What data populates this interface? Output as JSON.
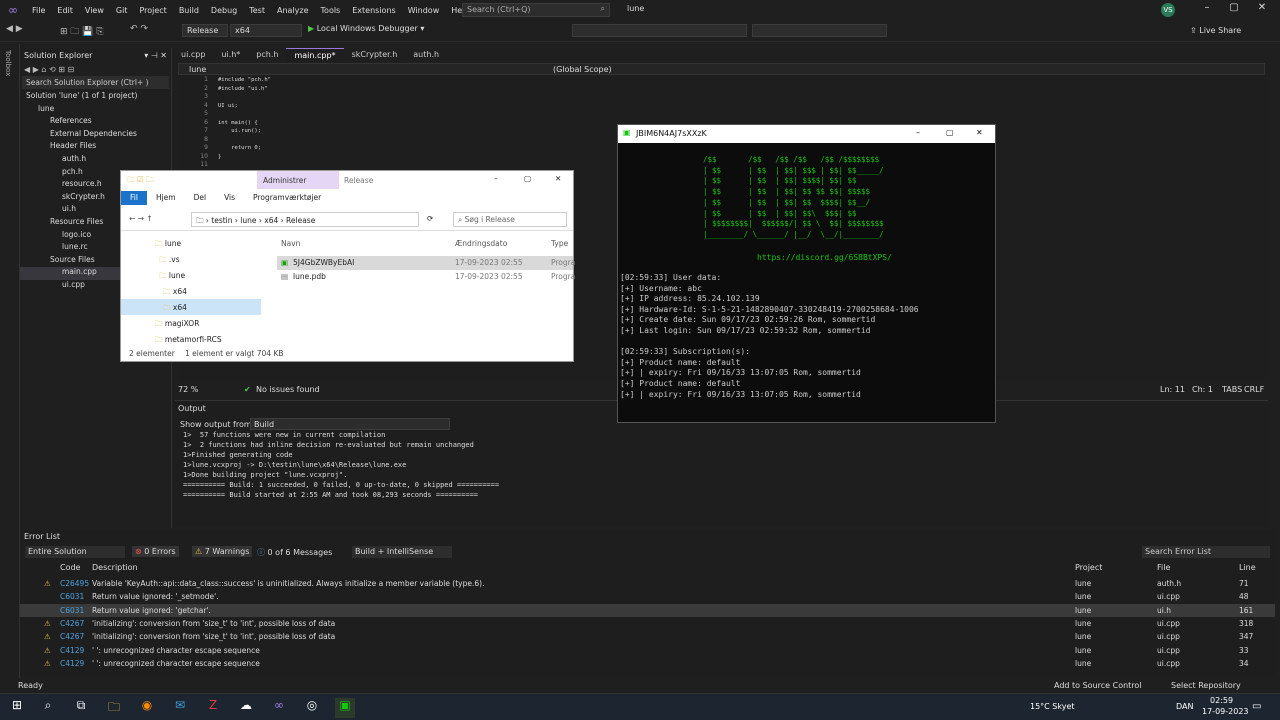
{
  "menu": [
    "File",
    "Edit",
    "View",
    "Git",
    "Project",
    "Build",
    "Debug",
    "Test",
    "Analyze",
    "Tools",
    "Extensions",
    "Window",
    "Help"
  ],
  "search_placeholder": "Search (Ctrl+Q)",
  "solution_name": "lune",
  "user_initials": "VS",
  "toolbar": {
    "config": "Release",
    "platform": "x64",
    "run_label": "Local Windows Debugger",
    "live_share": "Live Share"
  },
  "side_strip": "Toolbox",
  "solution_explorer": {
    "title": "Solution Explorer",
    "search": "Search Solution Explorer (Ctrl+ )",
    "items": [
      {
        "label": "Solution 'lune' (1 of 1 project)",
        "indent": 0
      },
      {
        "label": "lune",
        "indent": 1
      },
      {
        "label": "References",
        "indent": 2
      },
      {
        "label": "External Dependencies",
        "indent": 2
      },
      {
        "label": "Header Files",
        "indent": 2
      },
      {
        "label": "auth.h",
        "indent": 3
      },
      {
        "label": "pch.h",
        "indent": 3
      },
      {
        "label": "resource.h",
        "indent": 3
      },
      {
        "label": "skCrypter.h",
        "indent": 3
      },
      {
        "label": "ui.h",
        "indent": 3
      },
      {
        "label": "Resource Files",
        "indent": 2
      },
      {
        "label": "logo.ico",
        "indent": 3
      },
      {
        "label": "lune.rc",
        "indent": 3
      },
      {
        "label": "Source Files",
        "indent": 2
      },
      {
        "label": "main.cpp",
        "indent": 3
      },
      {
        "label": "ui.cpp",
        "indent": 3
      }
    ]
  },
  "tabs": [
    "ui.cpp",
    "ui.h*",
    "pch.h",
    "main.cpp*",
    "skCrypter.h",
    "auth.h"
  ],
  "nav": {
    "file": "lune",
    "scope": "(Global Scope)"
  },
  "code_lines": [
    "#include \"pch.h\"",
    "#include \"ui.h\"",
    "",
    "UI ui;",
    "",
    "int main() {",
    "    ui.run();",
    "",
    "    return 0;",
    "}",
    ""
  ],
  "editor_status": {
    "zoom": "72 %",
    "issues": "No issues found",
    "ln": "Ln: 11",
    "ch": "Ch: 1",
    "tabs": "TABS",
    "eol": "CRLF"
  },
  "output": {
    "title": "Output",
    "show_from_label": "Show output from:",
    "source": "Build",
    "lines": [
      "1>  57 functions were new in current compilation",
      "1>  2 functions had inline decision re-evaluated but remain unchanged",
      "1>Finished generating code",
      "1>lune.vcxproj -> D:\\testin\\lune\\x64\\Release\\lune.exe",
      "1>Done building project \"lune.vcxproj\".",
      "========== Build: 1 succeeded, 0 failed, 0 up-to-date, 0 skipped ==========",
      "========== Build started at 2:55 AM and took 08,293 seconds =========="
    ]
  },
  "error_list": {
    "title": "Error List",
    "scope": "Entire Solution",
    "errors": "0 Errors",
    "warnings": "7 Warnings",
    "messages": "0 of 6 Messages",
    "build_filter": "Build + IntelliSense",
    "search": "Search Error List",
    "headers": {
      "code": "Code",
      "description": "Description",
      "project": "Project",
      "file": "File",
      "line": "Line"
    },
    "rows": [
      {
        "code": "C26495",
        "desc": "Variable 'KeyAuth::api::data_class::success' is uninitialized. Always initialize a member variable (type.6).",
        "project": "lune",
        "file": "auth.h",
        "line": "71",
        "icon": true
      },
      {
        "code": "C6031",
        "desc": "Return value ignored: '_setmode'.",
        "project": "lune",
        "file": "ui.cpp",
        "line": "48",
        "icon": false
      },
      {
        "code": "C6031",
        "desc": "Return value ignored: 'getchar'.",
        "project": "lune",
        "file": "ui.h",
        "line": "161",
        "icon": false
      },
      {
        "code": "C4267",
        "desc": "'initializing': conversion from 'size_t' to 'int', possible loss of data",
        "project": "lune",
        "file": "ui.cpp",
        "line": "318",
        "icon": true
      },
      {
        "code": "C4267",
        "desc": "'initializing': conversion from 'size_t' to 'int', possible loss of data",
        "project": "lune",
        "file": "ui.cpp",
        "line": "347",
        "icon": true
      },
      {
        "code": "C4129",
        "desc": "' ': unrecognized character escape sequence",
        "project": "lune",
        "file": "ui.cpp",
        "line": "33",
        "icon": true
      },
      {
        "code": "C4129",
        "desc": "' ': unrecognized character escape sequence",
        "project": "lune",
        "file": "ui.cpp",
        "line": "34",
        "icon": true
      }
    ]
  },
  "statusbar": {
    "ready": "Ready",
    "add_source": "Add to Source Control",
    "select_repo": "Select Repository"
  },
  "taskbar": {
    "weather": "15°C  Skyet",
    "lang": "DAN",
    "time": "02:59",
    "date": "17-09-2023"
  },
  "explorer": {
    "ribbon_tab_admin": "Administrer",
    "ribbon_title": "Release",
    "tabs": [
      "Fil",
      "Hjem",
      "Del",
      "Vis",
      "Programværktøjer"
    ],
    "path": [
      "testin",
      "lune",
      "x64",
      "Release"
    ],
    "search": "Søg i Release",
    "tree": [
      "lune",
      ".vs",
      "lune",
      "x64",
      "x64",
      "magiXOR",
      "metamorfi-RCS"
    ],
    "columns": [
      "Navn",
      "Ændringsdato",
      "Type"
    ],
    "files": [
      {
        "name": "5J4GbZWByEbAI",
        "date": "17-09-2023 02:55",
        "type": "Progra"
      },
      {
        "name": "lune.pdb",
        "date": "17-09-2023 02:55",
        "type": "Progra"
      }
    ],
    "status_count": "2 elementer",
    "status_sel": "1 element er valgt  704 KB"
  },
  "console": {
    "title": "JBIM6N4AJ7sXXzK",
    "ascii": [
      "/$$       /$$   /$$ /$$   /$$ /$$$$$$$$",
      "| $$      | $$  | $$| $$$ | $$| $$_____/",
      "| $$      | $$  | $$| $$$$| $$| $$",
      "| $$      | $$  | $$| $$ $$ $$| $$$$$",
      "| $$      | $$  | $$| $$  $$$$| $$__/",
      "| $$      | $$  | $$| $$\\  $$$| $$",
      "| $$$$$$$$|  $$$$$$/| $$ \\  $$| $$$$$$$$",
      "|________/ \\______/ |__/  \\__/|________/"
    ],
    "link": "https://discord.gg/6S8BtXPS/",
    "lines": [
      "[02:59:33] User data:",
      "[+] Username: abc",
      "[+] IP address: 85.24.102.139",
      "[+] Hardware-Id: S-1-5-21-1482890407-330248419-2700258684-1006",
      "[+] Create date: Sun 09/17/23 02:59:26 Rom, sommertid",
      "[+] Last login: Sun 09/17/23 02:59:32 Rom, sommertid",
      "",
      "[02:59:33] Subscription(s):",
      "[+] Product name: default",
      "[+] | expiry: Fri 09/16/33 13:07:05 Rom, sommertid",
      "[+] Product name: default",
      "[+] | expiry: Fri 09/16/33 13:07:05 Rom, sommertid"
    ]
  }
}
